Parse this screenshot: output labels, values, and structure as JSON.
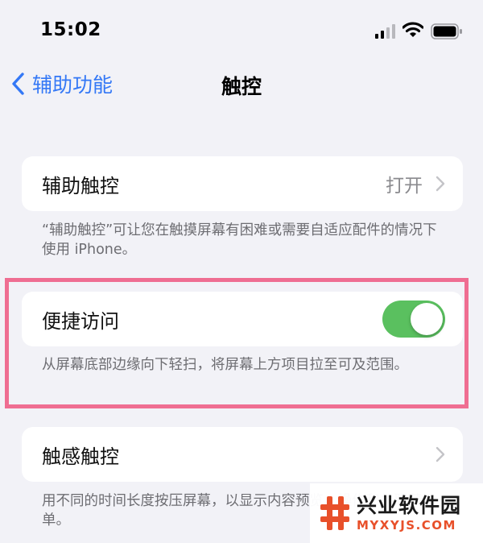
{
  "status_bar": {
    "time": "15:02"
  },
  "nav": {
    "back_label": "辅助功能",
    "title": "触控"
  },
  "assistive_touch": {
    "label": "辅助触控",
    "value": "打开",
    "footnote": "“辅助触控”可让您在触摸屏幕有困难或需要自适应配件的情况下使用 iPhone。"
  },
  "reachability": {
    "label": "便捷访问",
    "enabled": true,
    "footnote": "从屏幕底部边缘向下轻扫，将屏幕上方项目拉至可及范围。"
  },
  "haptic_touch": {
    "label": "触感触控",
    "footnote": "用不同的时间长度按压屏幕，以显示内容预览、操作和关联菜单。"
  },
  "watermark": {
    "title": "兴业软件园",
    "url": "MYXYJS.COM"
  },
  "colors": {
    "background": "#f2f2f7",
    "accent_blue": "#3478f6",
    "toggle_on": "#5ac05f",
    "highlight_pink": "#ef6e92",
    "watermark_orange": "#e8502a"
  }
}
